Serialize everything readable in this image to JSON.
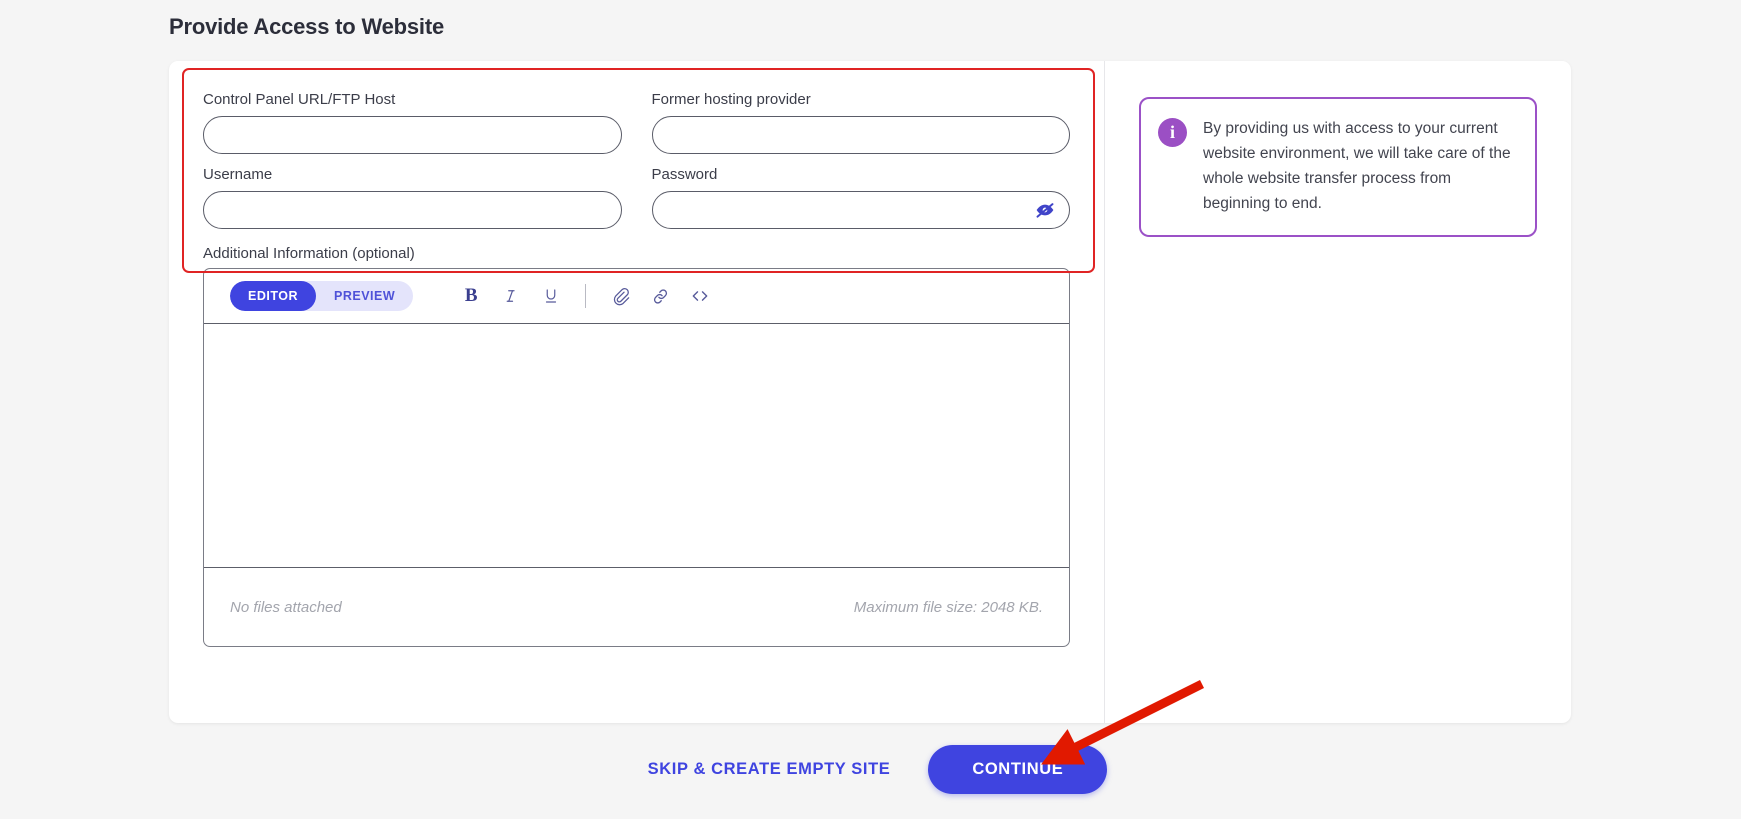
{
  "page": {
    "title": "Provide Access to Website"
  },
  "form": {
    "fields": [
      {
        "label": "Control Panel URL/FTP Host",
        "value": "",
        "placeholder": "",
        "name": "control-panel-url-field"
      },
      {
        "label": "Former hosting provider",
        "value": "",
        "placeholder": "",
        "name": "former-hosting-provider-field"
      },
      {
        "label": "Username",
        "value": "",
        "placeholder": "",
        "name": "username-field"
      },
      {
        "label": "Password",
        "value": "",
        "placeholder": "",
        "name": "password-field"
      }
    ],
    "password_toggle_icon": "eye-off-icon"
  },
  "additional_information": {
    "label": "Additional Information (optional)",
    "editor": {
      "tabs": [
        {
          "label": "EDITOR",
          "active": true
        },
        {
          "label": "PREVIEW",
          "active": false
        }
      ],
      "tools": [
        {
          "icon": "bold-icon",
          "glyph": "B"
        },
        {
          "icon": "italic-icon",
          "glyph": "I"
        },
        {
          "icon": "underline-icon",
          "glyph": "U"
        },
        {
          "icon": "attachment-icon",
          "glyph": "paperclip"
        },
        {
          "icon": "link-icon",
          "glyph": "link"
        },
        {
          "icon": "code-icon",
          "glyph": "</>"
        }
      ],
      "body_text": "",
      "footer_left": "No files attached",
      "footer_right": "Maximum file size: 2048 KB."
    }
  },
  "info_callout": {
    "icon": "info-circle-icon",
    "text": "By providing us with access to your current website environment, we will take care of the whole website transfer process from beginning to end."
  },
  "actions": {
    "skip_label": "SKIP & CREATE EMPTY SITE",
    "continue_label": "CONTINUE"
  },
  "annotations": {
    "highlight_color": "#e02424",
    "arrow_color": "#e11900"
  },
  "colors": {
    "accent": "#3f44e0",
    "accent_soft": "#e4e4fb",
    "info_purple": "#9b51c7",
    "page_bg": "#f5f5f5",
    "card_bg": "#ffffff"
  }
}
